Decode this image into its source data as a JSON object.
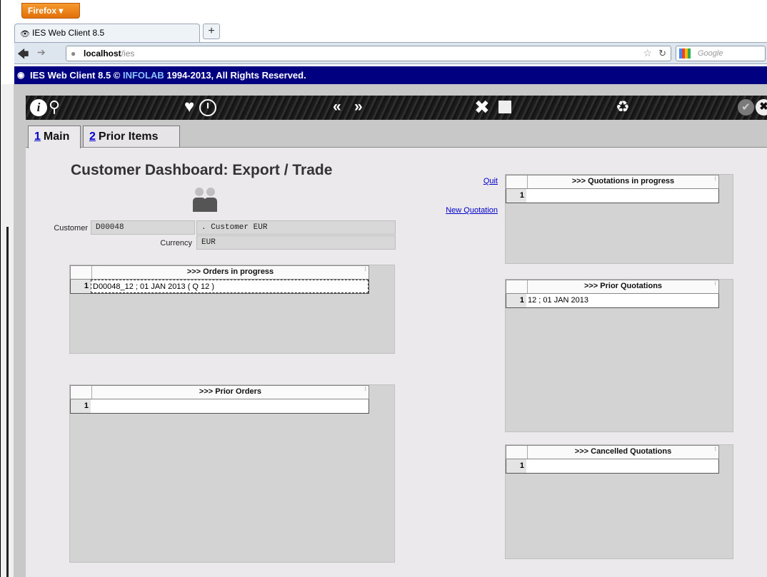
{
  "browser": {
    "menu_label": "Firefox ▾",
    "tab_title": "IES Web Client 8.5",
    "new_tab": "+",
    "url_host": "localhost",
    "url_path": "/ies",
    "search_placeholder": "Google"
  },
  "app": {
    "title_prefix": "IES Web Client 8.5 © ",
    "title_company": "INFOLAB",
    "title_suffix": " 1994-2013, All Rights Reserved."
  },
  "toolbar": {
    "info": "i",
    "search": "⚲",
    "heart": "♥",
    "prev": "«",
    "next": "»",
    "tools": "✖",
    "recycle": "♻",
    "ok": "✔",
    "cancel": "✖"
  },
  "tabs": [
    {
      "num": "1",
      "label": "Main"
    },
    {
      "num": "2",
      "label": "Prior Items"
    }
  ],
  "page_title": "Customer Dashboard: Export / Trade",
  "customer": {
    "label": "Customer",
    "code": "D00048",
    "name": ". Customer EUR",
    "currency_label": "Currency",
    "currency": "EUR"
  },
  "links": {
    "quit": "Quit",
    "new_quotation": "New Quotation"
  },
  "grids": {
    "orders_in_progress": {
      "title": ">>> Orders in progress",
      "rows": [
        {
          "n": "1",
          "value": "D00048_12 ; 01 JAN 2013 ( Q 12 )"
        }
      ]
    },
    "prior_orders": {
      "title": ">>> Prior Orders",
      "rows": [
        {
          "n": "1",
          "value": ""
        }
      ]
    },
    "quotations_in_progress": {
      "title": ">>> Quotations in progress",
      "rows": [
        {
          "n": "1",
          "value": ""
        }
      ]
    },
    "prior_quotations": {
      "title": ">>> Prior Quotations",
      "rows": [
        {
          "n": "1",
          "value": "12 ; 01 JAN 2013"
        }
      ]
    },
    "cancelled_quotations": {
      "title": ">>> Cancelled Quotations",
      "rows": [
        {
          "n": "1",
          "value": ""
        }
      ]
    }
  }
}
